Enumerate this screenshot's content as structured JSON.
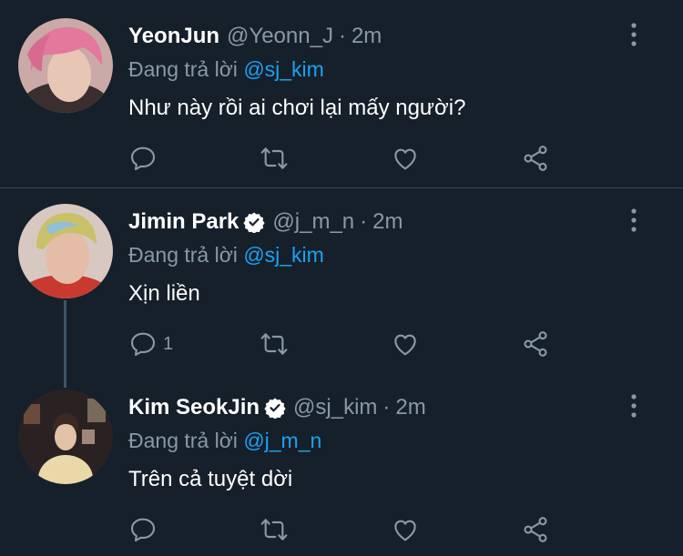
{
  "colors": {
    "background": "#15202b",
    "muted": "#8899a6",
    "accent": "#1da1f2",
    "divider": "#38444d"
  },
  "tweets": [
    {
      "name": "YeonJun",
      "verified": false,
      "handle": "@Yeonn_J",
      "dot": "·",
      "time": "2m",
      "reply_prefix": "Đang trả lời",
      "reply_to": "@sj_kim",
      "text": "Như này rồi ai chơi lại mấy người?",
      "reply_count": "",
      "icons": [
        "reply-icon",
        "retweet-icon",
        "like-icon",
        "share-icon",
        "more-icon"
      ]
    },
    {
      "name": "Jimin Park",
      "verified": true,
      "handle": "@j_m_n",
      "dot": "·",
      "time": "2m",
      "reply_prefix": "Đang trả lời",
      "reply_to": "@sj_kim",
      "text": "Xịn liền",
      "reply_count": "1",
      "icons": [
        "reply-icon",
        "retweet-icon",
        "like-icon",
        "share-icon",
        "more-icon"
      ]
    },
    {
      "name": "Kim SeokJin",
      "verified": true,
      "handle": "@sj_kim",
      "dot": "·",
      "time": "2m",
      "reply_prefix": "Đang trả lời",
      "reply_to": "@j_m_n",
      "text": "Trên cả tuyệt dời",
      "reply_count": "",
      "icons": [
        "reply-icon",
        "retweet-icon",
        "like-icon",
        "share-icon",
        "more-icon"
      ]
    }
  ]
}
